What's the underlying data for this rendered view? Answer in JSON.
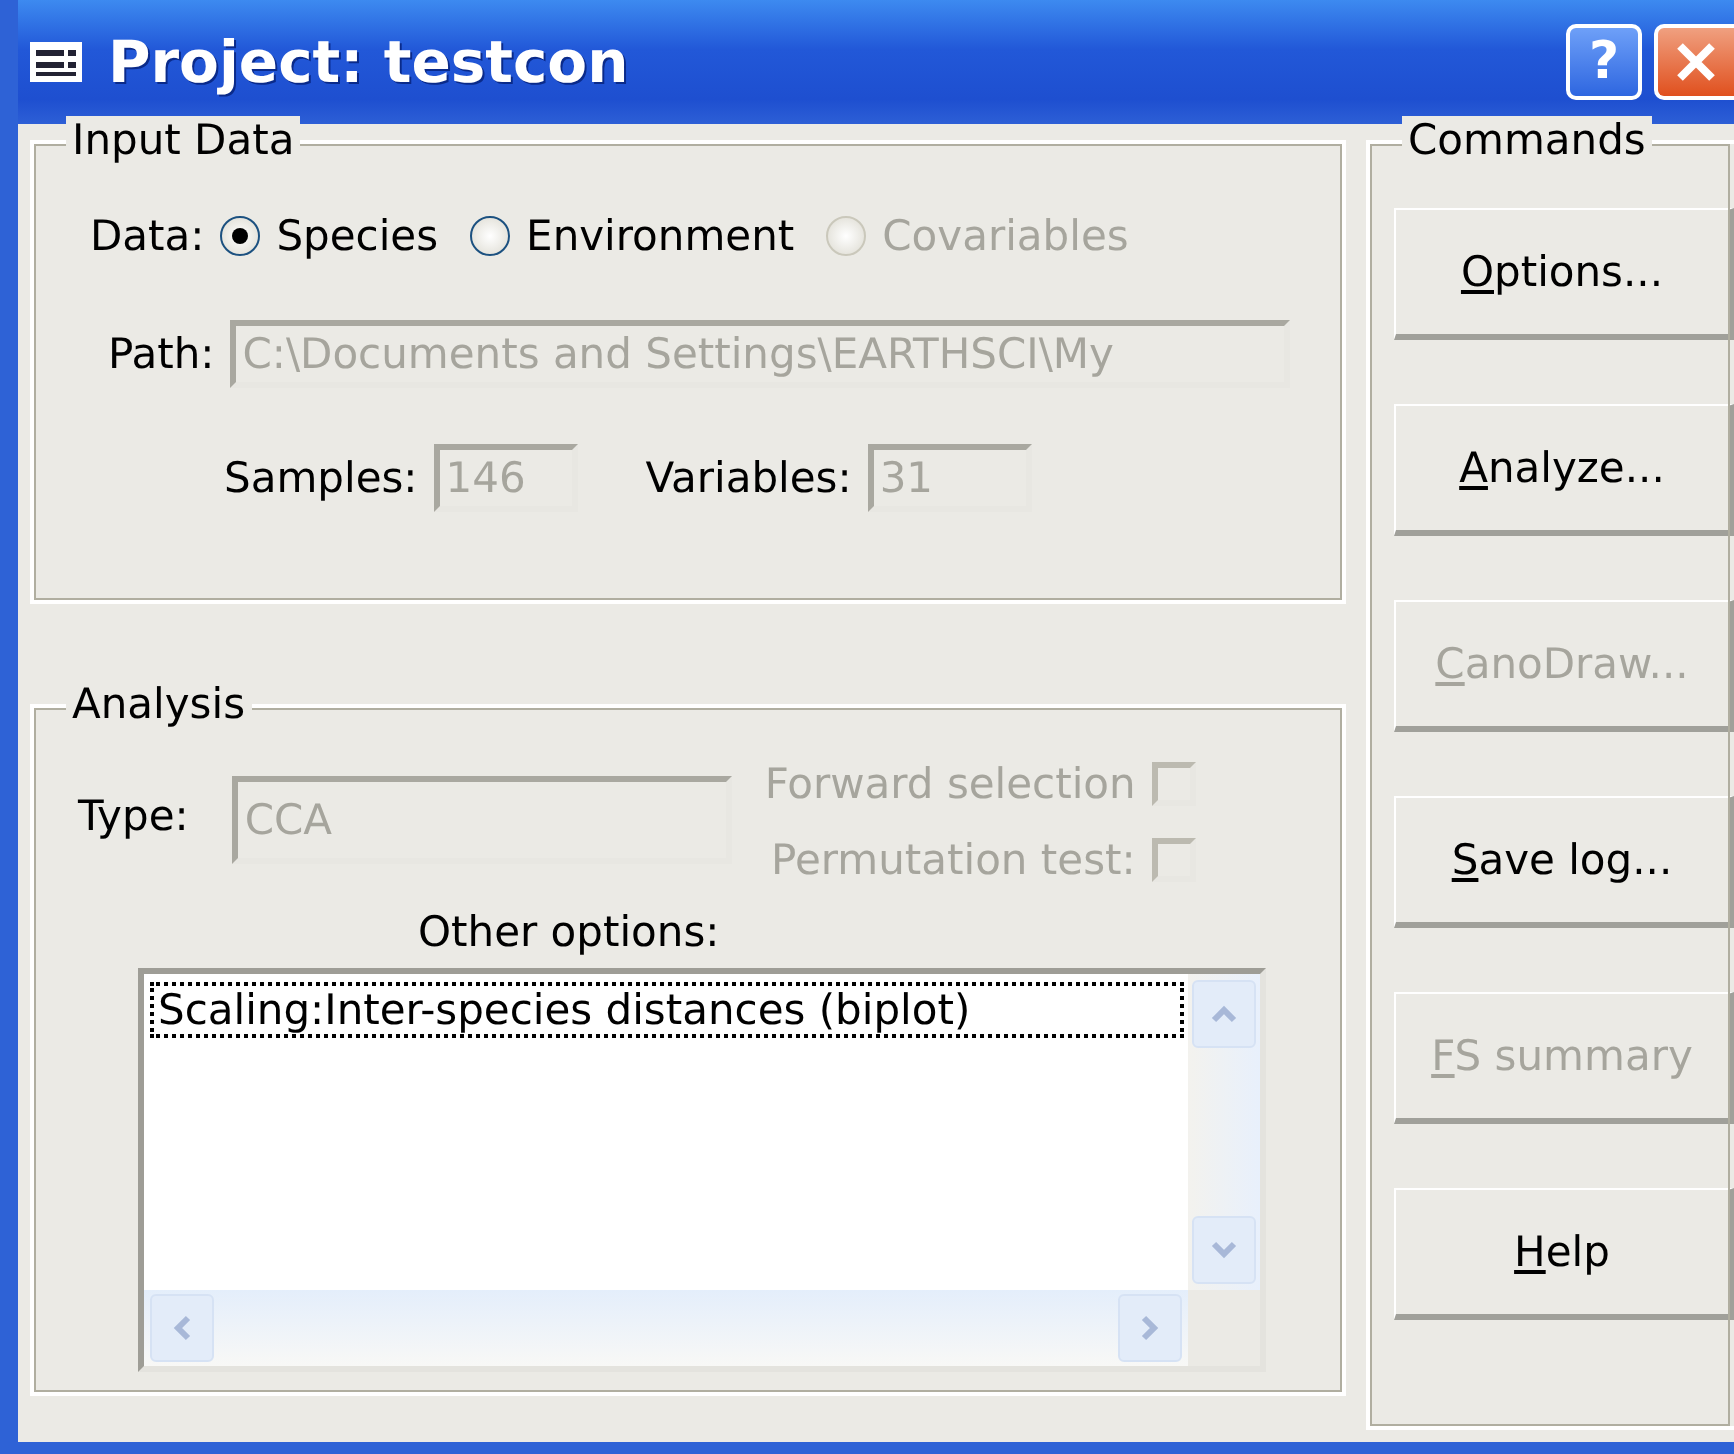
{
  "window": {
    "title": "Project: testcon",
    "help_label": "?"
  },
  "input_data": {
    "legend": "Input Data",
    "data_label": "Data:",
    "radios": [
      {
        "label": "Species",
        "selected": true,
        "disabled": false
      },
      {
        "label": "Environment",
        "selected": false,
        "disabled": false
      },
      {
        "label": "Covariables",
        "selected": false,
        "disabled": true
      }
    ],
    "path": {
      "label": "Path:",
      "value": "C:\\Documents and Settings\\EARTHSCI\\My",
      "disabled": true
    },
    "samples": {
      "label": "Samples:",
      "value": "146",
      "disabled": true
    },
    "variables": {
      "label": "Variables:",
      "value": "31",
      "disabled": true
    }
  },
  "analysis": {
    "legend": "Analysis",
    "type": {
      "label": "Type:",
      "value": "CCA",
      "disabled": true
    },
    "checks": [
      {
        "label": "Forward selection",
        "checked": false,
        "disabled": true
      },
      {
        "label": "Permutation test:",
        "checked": false,
        "disabled": true
      }
    ],
    "other_label": "Other options:",
    "options": [
      {
        "text": "Scaling:Inter-species distances (biplot)",
        "focused": true
      }
    ]
  },
  "commands": {
    "legend": "Commands",
    "buttons": [
      {
        "accel": "O",
        "rest": "ptions...",
        "disabled": false
      },
      {
        "accel": "A",
        "rest": "nalyze...",
        "disabled": false
      },
      {
        "accel": "C",
        "rest": "anoDraw...",
        "disabled": true
      },
      {
        "accel": "S",
        "rest": "ave log...",
        "disabled": false
      },
      {
        "accel": "F",
        "rest": "S summary",
        "disabled": true
      },
      {
        "accel": "H",
        "rest": "elp",
        "disabled": false
      }
    ]
  }
}
